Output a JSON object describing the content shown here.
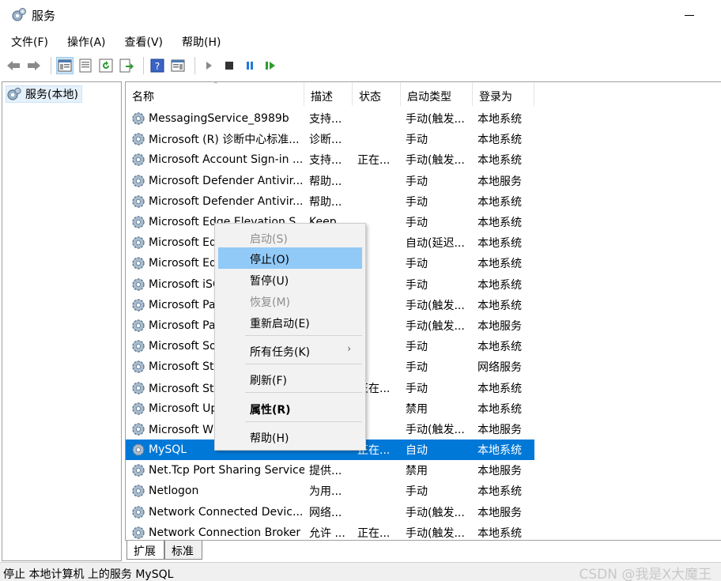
{
  "window": {
    "title": "服务"
  },
  "menu": [
    "文件(F)",
    "操作(A)",
    "查看(V)",
    "帮助(H)"
  ],
  "tree": {
    "root_label": "服务(本地)"
  },
  "columns": [
    "名称",
    "描述",
    "状态",
    "启动类型",
    "登录为"
  ],
  "services": [
    {
      "name": "MessagingService_8989b",
      "desc": "支持...",
      "status": "",
      "startup": "手动(触发...",
      "logon": "本地系统"
    },
    {
      "name": "Microsoft (R) 诊断中心标准...",
      "desc": "诊断...",
      "status": "",
      "startup": "手动",
      "logon": "本地系统"
    },
    {
      "name": "Microsoft Account Sign-in ...",
      "desc": "支持...",
      "status": "正在...",
      "startup": "手动(触发...",
      "logon": "本地系统"
    },
    {
      "name": "Microsoft Defender Antivir...",
      "desc": "帮助...",
      "status": "",
      "startup": "手动",
      "logon": "本地服务"
    },
    {
      "name": "Microsoft Defender Antivir...",
      "desc": "帮助...",
      "status": "",
      "startup": "手动",
      "logon": "本地系统"
    },
    {
      "name": "Microsoft Edge Elevation S...",
      "desc": "Keep...",
      "status": "",
      "startup": "手动",
      "logon": "本地系统"
    },
    {
      "name": "Microsoft Edge Update Serv...",
      "desc": "",
      "status": "",
      "startup": "自动(延迟...",
      "logon": "本地系统"
    },
    {
      "name": "Microsoft Edge Update Serv...",
      "desc": "",
      "status": "",
      "startup": "手动",
      "logon": "本地系统"
    },
    {
      "name": "Microsoft iSCSI Initiator ...",
      "desc": "",
      "status": "",
      "startup": "手动",
      "logon": "本地系统"
    },
    {
      "name": "Microsoft Passport",
      "desc": "",
      "status": "",
      "startup": "手动(触发...",
      "logon": "本地系统"
    },
    {
      "name": "Microsoft Passport Contai...",
      "desc": "",
      "status": "",
      "startup": "手动(触发...",
      "logon": "本地服务"
    },
    {
      "name": "Microsoft Software Shado...",
      "desc": "",
      "status": "",
      "startup": "手动",
      "logon": "本地系统"
    },
    {
      "name": "Microsoft Storage Spaces ...",
      "desc": "",
      "status": "",
      "startup": "手动",
      "logon": "网络服务"
    },
    {
      "name": "Microsoft Store 安装服务",
      "desc": "",
      "status": "正在...",
      "startup": "手动",
      "logon": "本地系统"
    },
    {
      "name": "Microsoft Update Health ...",
      "desc": "",
      "status": "",
      "startup": "禁用",
      "logon": "本地系统"
    },
    {
      "name": "Microsoft Windows SMS 路...",
      "desc": "",
      "status": "",
      "startup": "手动(触发...",
      "logon": "本地服务"
    },
    {
      "name": "MySQL",
      "desc": "",
      "status": "正在...",
      "startup": "自动",
      "logon": "本地系统",
      "selected": true
    },
    {
      "name": "Net.Tcp Port Sharing Service",
      "desc": "提供...",
      "status": "",
      "startup": "禁用",
      "logon": "本地服务"
    },
    {
      "name": "Netlogon",
      "desc": "为用...",
      "status": "",
      "startup": "手动",
      "logon": "本地系统"
    },
    {
      "name": "Network Connected Devic...",
      "desc": "网络...",
      "status": "",
      "startup": "手动(触发...",
      "logon": "本地服务"
    },
    {
      "name": "Network Connection Broker",
      "desc": "允许 ...",
      "status": "正在...",
      "startup": "手动(触发...",
      "logon": "本地系统"
    }
  ],
  "context_menu": {
    "start": "启动(S)",
    "stop": "停止(O)",
    "pause": "暂停(U)",
    "resume": "恢复(M)",
    "restart": "重新启动(E)",
    "all_tasks": "所有任务(K)",
    "refresh": "刷新(F)",
    "properties": "属性(R)",
    "help": "帮助(H)"
  },
  "tabs": {
    "extended": "扩展",
    "standard": "标准"
  },
  "status_bar": {
    "text": "停止 本地计算机 上的服务 MySQL"
  },
  "watermark": "CSDN @我是X大魔王"
}
